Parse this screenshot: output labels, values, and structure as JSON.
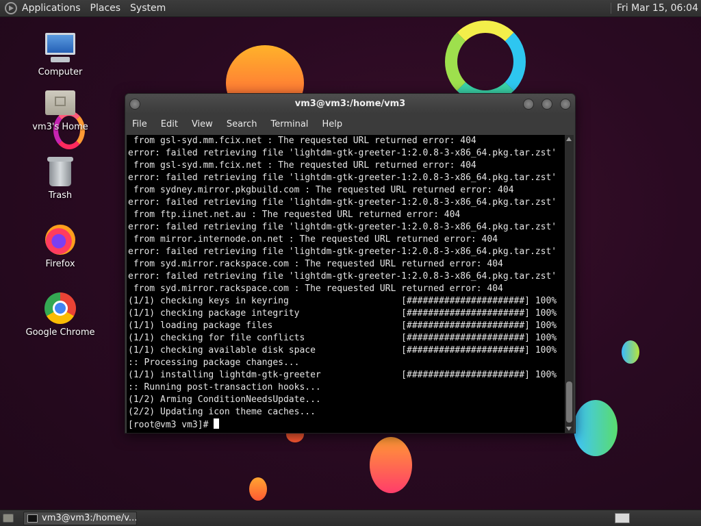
{
  "top_panel": {
    "menus": [
      "Applications",
      "Places",
      "System"
    ],
    "clock": "Fri Mar 15, 06:04"
  },
  "desktop_icons": [
    {
      "label": "Computer",
      "icon": "computer-icon"
    },
    {
      "label": "vm3's Home",
      "icon": "home-folder-icon"
    },
    {
      "label": "Trash",
      "icon": "trash-icon"
    },
    {
      "label": "Firefox",
      "icon": "firefox-icon"
    },
    {
      "label": "Google Chrome",
      "icon": "chrome-icon"
    }
  ],
  "window": {
    "title": "vm3@vm3:/home/vm3",
    "menu": [
      "File",
      "Edit",
      "View",
      "Search",
      "Terminal",
      "Help"
    ]
  },
  "terminal": {
    "lines": [
      " from gsl-syd.mm.fcix.net : The requested URL returned error: 404",
      "error: failed retrieving file 'lightdm-gtk-greeter-1:2.0.8-3-x86_64.pkg.tar.zst'",
      " from gsl-syd.mm.fcix.net : The requested URL returned error: 404",
      "error: failed retrieving file 'lightdm-gtk-greeter-1:2.0.8-3-x86_64.pkg.tar.zst'",
      " from sydney.mirror.pkgbuild.com : The requested URL returned error: 404",
      "error: failed retrieving file 'lightdm-gtk-greeter-1:2.0.8-3-x86_64.pkg.tar.zst'",
      " from ftp.iinet.net.au : The requested URL returned error: 404",
      "error: failed retrieving file 'lightdm-gtk-greeter-1:2.0.8-3-x86_64.pkg.tar.zst'",
      " from mirror.internode.on.net : The requested URL returned error: 404",
      "error: failed retrieving file 'lightdm-gtk-greeter-1:2.0.8-3-x86_64.pkg.tar.zst'",
      " from syd.mirror.rackspace.com : The requested URL returned error: 404",
      "error: failed retrieving file 'lightdm-gtk-greeter-1:2.0.8-3-x86_64.pkg.tar.zst'",
      " from syd.mirror.rackspace.com : The requested URL returned error: 404",
      "(1/1) checking keys in keyring                     [######################] 100%",
      "(1/1) checking package integrity                   [######################] 100%",
      "(1/1) loading package files                        [######################] 100%",
      "(1/1) checking for file conflicts                  [######################] 100%",
      "(1/1) checking available disk space                [######################] 100%",
      ":: Processing package changes...",
      "(1/1) installing lightdm-gtk-greeter               [######################] 100%",
      ":: Running post-transaction hooks...",
      "(1/2) Arming ConditionNeedsUpdate...",
      "(2/2) Updating icon theme caches..."
    ],
    "prompt": "[root@vm3 vm3]# "
  },
  "taskbar": {
    "task_label": "vm3@vm3:/home/v..."
  }
}
